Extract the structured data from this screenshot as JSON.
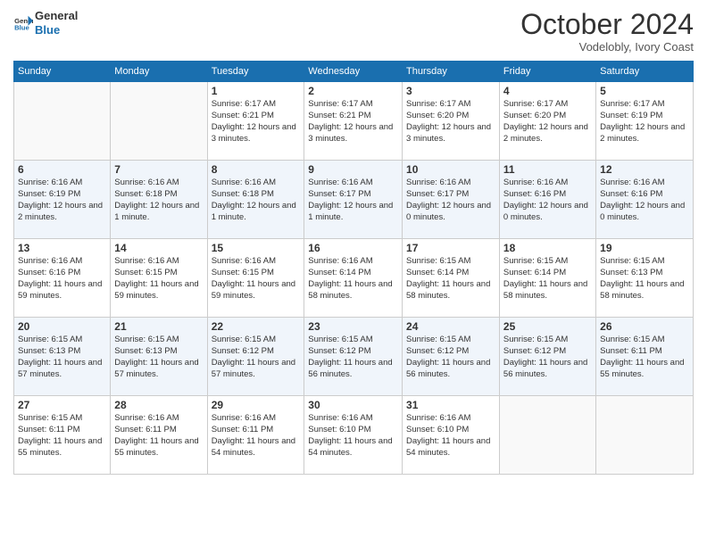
{
  "header": {
    "logo_line1": "General",
    "logo_line2": "Blue",
    "month_title": "October 2024",
    "location": "Vodelobly, Ivory Coast"
  },
  "days_of_week": [
    "Sunday",
    "Monday",
    "Tuesday",
    "Wednesday",
    "Thursday",
    "Friday",
    "Saturday"
  ],
  "weeks": [
    [
      null,
      null,
      {
        "day": 1,
        "sunrise": "Sunrise: 6:17 AM",
        "sunset": "Sunset: 6:21 PM",
        "daylight": "Daylight: 12 hours and 3 minutes."
      },
      {
        "day": 2,
        "sunrise": "Sunrise: 6:17 AM",
        "sunset": "Sunset: 6:21 PM",
        "daylight": "Daylight: 12 hours and 3 minutes."
      },
      {
        "day": 3,
        "sunrise": "Sunrise: 6:17 AM",
        "sunset": "Sunset: 6:20 PM",
        "daylight": "Daylight: 12 hours and 3 minutes."
      },
      {
        "day": 4,
        "sunrise": "Sunrise: 6:17 AM",
        "sunset": "Sunset: 6:20 PM",
        "daylight": "Daylight: 12 hours and 2 minutes."
      },
      {
        "day": 5,
        "sunrise": "Sunrise: 6:17 AM",
        "sunset": "Sunset: 6:19 PM",
        "daylight": "Daylight: 12 hours and 2 minutes."
      }
    ],
    [
      {
        "day": 6,
        "sunrise": "Sunrise: 6:16 AM",
        "sunset": "Sunset: 6:19 PM",
        "daylight": "Daylight: 12 hours and 2 minutes."
      },
      {
        "day": 7,
        "sunrise": "Sunrise: 6:16 AM",
        "sunset": "Sunset: 6:18 PM",
        "daylight": "Daylight: 12 hours and 1 minute."
      },
      {
        "day": 8,
        "sunrise": "Sunrise: 6:16 AM",
        "sunset": "Sunset: 6:18 PM",
        "daylight": "Daylight: 12 hours and 1 minute."
      },
      {
        "day": 9,
        "sunrise": "Sunrise: 6:16 AM",
        "sunset": "Sunset: 6:17 PM",
        "daylight": "Daylight: 12 hours and 1 minute."
      },
      {
        "day": 10,
        "sunrise": "Sunrise: 6:16 AM",
        "sunset": "Sunset: 6:17 PM",
        "daylight": "Daylight: 12 hours and 0 minutes."
      },
      {
        "day": 11,
        "sunrise": "Sunrise: 6:16 AM",
        "sunset": "Sunset: 6:16 PM",
        "daylight": "Daylight: 12 hours and 0 minutes."
      },
      {
        "day": 12,
        "sunrise": "Sunrise: 6:16 AM",
        "sunset": "Sunset: 6:16 PM",
        "daylight": "Daylight: 12 hours and 0 minutes."
      }
    ],
    [
      {
        "day": 13,
        "sunrise": "Sunrise: 6:16 AM",
        "sunset": "Sunset: 6:16 PM",
        "daylight": "Daylight: 11 hours and 59 minutes."
      },
      {
        "day": 14,
        "sunrise": "Sunrise: 6:16 AM",
        "sunset": "Sunset: 6:15 PM",
        "daylight": "Daylight: 11 hours and 59 minutes."
      },
      {
        "day": 15,
        "sunrise": "Sunrise: 6:16 AM",
        "sunset": "Sunset: 6:15 PM",
        "daylight": "Daylight: 11 hours and 59 minutes."
      },
      {
        "day": 16,
        "sunrise": "Sunrise: 6:16 AM",
        "sunset": "Sunset: 6:14 PM",
        "daylight": "Daylight: 11 hours and 58 minutes."
      },
      {
        "day": 17,
        "sunrise": "Sunrise: 6:15 AM",
        "sunset": "Sunset: 6:14 PM",
        "daylight": "Daylight: 11 hours and 58 minutes."
      },
      {
        "day": 18,
        "sunrise": "Sunrise: 6:15 AM",
        "sunset": "Sunset: 6:14 PM",
        "daylight": "Daylight: 11 hours and 58 minutes."
      },
      {
        "day": 19,
        "sunrise": "Sunrise: 6:15 AM",
        "sunset": "Sunset: 6:13 PM",
        "daylight": "Daylight: 11 hours and 58 minutes."
      }
    ],
    [
      {
        "day": 20,
        "sunrise": "Sunrise: 6:15 AM",
        "sunset": "Sunset: 6:13 PM",
        "daylight": "Daylight: 11 hours and 57 minutes."
      },
      {
        "day": 21,
        "sunrise": "Sunrise: 6:15 AM",
        "sunset": "Sunset: 6:13 PM",
        "daylight": "Daylight: 11 hours and 57 minutes."
      },
      {
        "day": 22,
        "sunrise": "Sunrise: 6:15 AM",
        "sunset": "Sunset: 6:12 PM",
        "daylight": "Daylight: 11 hours and 57 minutes."
      },
      {
        "day": 23,
        "sunrise": "Sunrise: 6:15 AM",
        "sunset": "Sunset: 6:12 PM",
        "daylight": "Daylight: 11 hours and 56 minutes."
      },
      {
        "day": 24,
        "sunrise": "Sunrise: 6:15 AM",
        "sunset": "Sunset: 6:12 PM",
        "daylight": "Daylight: 11 hours and 56 minutes."
      },
      {
        "day": 25,
        "sunrise": "Sunrise: 6:15 AM",
        "sunset": "Sunset: 6:12 PM",
        "daylight": "Daylight: 11 hours and 56 minutes."
      },
      {
        "day": 26,
        "sunrise": "Sunrise: 6:15 AM",
        "sunset": "Sunset: 6:11 PM",
        "daylight": "Daylight: 11 hours and 55 minutes."
      }
    ],
    [
      {
        "day": 27,
        "sunrise": "Sunrise: 6:15 AM",
        "sunset": "Sunset: 6:11 PM",
        "daylight": "Daylight: 11 hours and 55 minutes."
      },
      {
        "day": 28,
        "sunrise": "Sunrise: 6:16 AM",
        "sunset": "Sunset: 6:11 PM",
        "daylight": "Daylight: 11 hours and 55 minutes."
      },
      {
        "day": 29,
        "sunrise": "Sunrise: 6:16 AM",
        "sunset": "Sunset: 6:11 PM",
        "daylight": "Daylight: 11 hours and 54 minutes."
      },
      {
        "day": 30,
        "sunrise": "Sunrise: 6:16 AM",
        "sunset": "Sunset: 6:10 PM",
        "daylight": "Daylight: 11 hours and 54 minutes."
      },
      {
        "day": 31,
        "sunrise": "Sunrise: 6:16 AM",
        "sunset": "Sunset: 6:10 PM",
        "daylight": "Daylight: 11 hours and 54 minutes."
      },
      null,
      null
    ]
  ]
}
